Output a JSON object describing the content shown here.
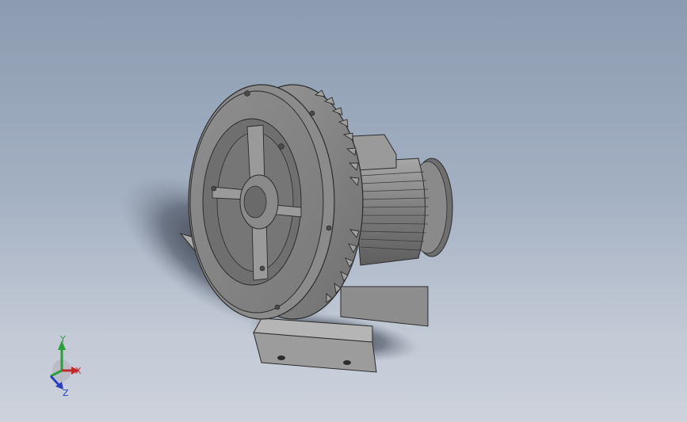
{
  "viewport": {
    "background_top": "#8c9bb0",
    "background_bottom": "#cdd2dc",
    "model": {
      "description_icon": "ring-blower-3d-model",
      "body_color": "#8f8f8f",
      "edge_color": "#2b2b2b"
    },
    "triad": {
      "x_label": "X",
      "y_label": "Y",
      "z_label": "Z",
      "x_color": "#c0282a",
      "y_color": "#2aa03a",
      "z_color": "#2a3ec0"
    }
  }
}
